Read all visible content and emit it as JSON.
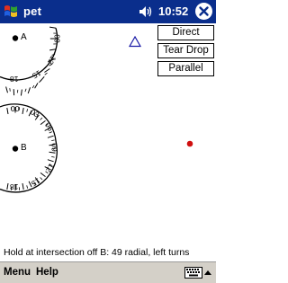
{
  "window": {
    "title": "pet",
    "clock": "10:52"
  },
  "icons": {
    "start": "windows-flag-icon",
    "volume": "speaker-icon",
    "close": "close-x-icon",
    "keyboard": "keyboard-icon",
    "input_arrow": "up-arrow-icon"
  },
  "entry_buttons": {
    "direct": "Direct",
    "tear_drop": "Tear Drop",
    "parallel": "Parallel"
  },
  "fix_a": {
    "label": "A",
    "tick_labels": [
      "09",
      "12",
      "15",
      "18"
    ]
  },
  "fix_b": {
    "label": "B",
    "tick_labels": [
      "00",
      "03",
      "06",
      "09",
      "12",
      "15",
      "18"
    ]
  },
  "status": "Hold at intersection off B: 49 radial, left turns",
  "menu": {
    "menu": "Menu",
    "help": "Help"
  },
  "colors": {
    "titlebar": "#0a2e8c",
    "aircraft_triangle": "#1a1aa6",
    "target_dot": "#d01010"
  }
}
